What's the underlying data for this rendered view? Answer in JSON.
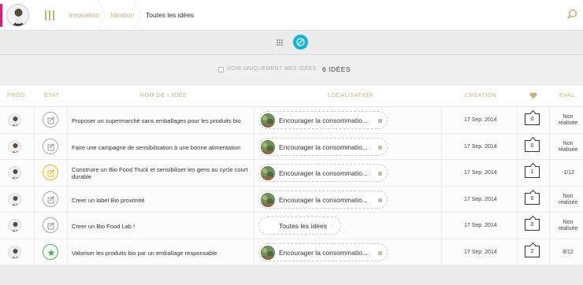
{
  "breadcrumb": [
    "Innovation",
    "Ideation",
    "Toutes les idées"
  ],
  "colors": {
    "accent": "#e5197a",
    "gold": "#c2b47e",
    "toggle": "#17b3d6"
  },
  "filter": {
    "label": "VOIR UNIQUEMENT MES IDÉES",
    "count": "6 IDÉES"
  },
  "columns": {
    "prod": "PROD.",
    "etat": "ÉTAT",
    "nom": "NOM DE L'IDÉE",
    "localisation": "LOCALISATION",
    "creation": "CRÉATION",
    "eval": "EVAL."
  },
  "rows": [
    {
      "name": "Proposer un supermarché sans emballages pour les produits bio",
      "location": "Encourager la consommatio...",
      "date": "17 Sep. 2014",
      "likes": "0",
      "eval": "Non réalisée",
      "state": "gray"
    },
    {
      "name": "Faire une campagne de sensibilisation à une bonne alimentation",
      "location": "Encourager la consommatio...",
      "date": "17 Sep. 2014",
      "likes": "0",
      "eval": "Non réalisée",
      "state": "gray"
    },
    {
      "name": "Construire un Bio Food Truck et sensibiliser les gens au cycle court durable",
      "location": "Encourager la consommatio...",
      "date": "17 Sep. 2014",
      "likes": "1",
      "eval": "-1/12",
      "state": "orange"
    },
    {
      "name": "Creer un label Bio proximité",
      "location": "Encourager la consommatio...",
      "date": "17 Sep. 2014",
      "likes": "0",
      "eval": "Non réalisée",
      "state": "gray"
    },
    {
      "name": "Creer un Bio Food Lab !",
      "location": "Toutes les idées",
      "date": "17 Sep. 2014",
      "likes": "0",
      "eval": "Non réalisée",
      "state": "gray"
    },
    {
      "name": "Valoriser les produits bio par un emballage responsable",
      "location": "Encourager la consommatio...",
      "date": "17 Sep. 2014",
      "likes": "2",
      "eval": "8/12",
      "state": "green"
    }
  ]
}
